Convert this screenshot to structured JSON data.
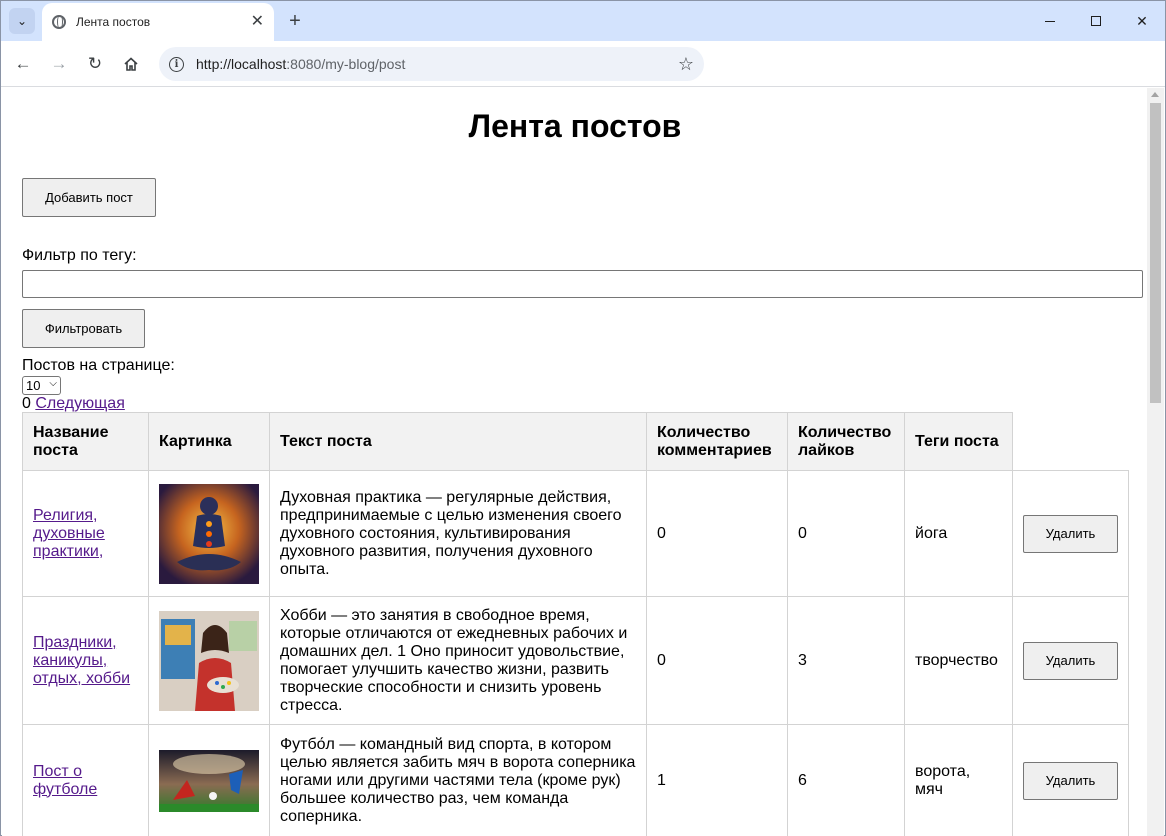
{
  "browser": {
    "tab_title": "Лента постов",
    "url_host": "http://localhost",
    "url_path": ":8080/my-blog/post"
  },
  "page": {
    "heading": "Лента постов",
    "add_post_label": "Добавить пост",
    "filter_label": "Фильтр по тегу:",
    "filter_value": "",
    "filter_button_label": "Фильтровать",
    "per_page_label": "Постов на странице:",
    "per_page_selected": "10",
    "page_number": "0",
    "next_link_label": "Следующая"
  },
  "table": {
    "headers": {
      "title": "Название поста",
      "image": "Картинка",
      "text": "Текст поста",
      "comments": "Количество комментариев",
      "likes": "Количество лайков",
      "tags": "Теги поста"
    },
    "delete_label": "Удалить",
    "rows": [
      {
        "title": "Религия, духовные практики,",
        "text": "Духовная практика — регулярные действия, предпринимаемые с целью изменения своего духовного состояния, культивирования духовного развития, получения духовного опыта.",
        "comments": "0",
        "likes": "0",
        "tags": "йога",
        "image": "meditation-image"
      },
      {
        "title": "Праздники, каникулы, отдых, хобби",
        "text": "Хобби — это занятия в свободное время, которые отличаются от ежедневных рабочих и домашних дел. 1 Оно приносит удовольствие, помогает улучшить качество жизни, развить творческие способности и снизить уровень стресса.",
        "comments": "0",
        "likes": "3",
        "tags": "творчество",
        "image": "painter-image"
      },
      {
        "title": "Пост о футболе",
        "text": "Футбо́л — командный вид спорта, в котором целью является забить мяч в ворота соперника ногами или другими частями тела (кроме рук) большее количество раз, чем команда соперника.",
        "comments": "1",
        "likes": "6",
        "tags": "ворота, мяч",
        "image": "football-image"
      }
    ]
  }
}
